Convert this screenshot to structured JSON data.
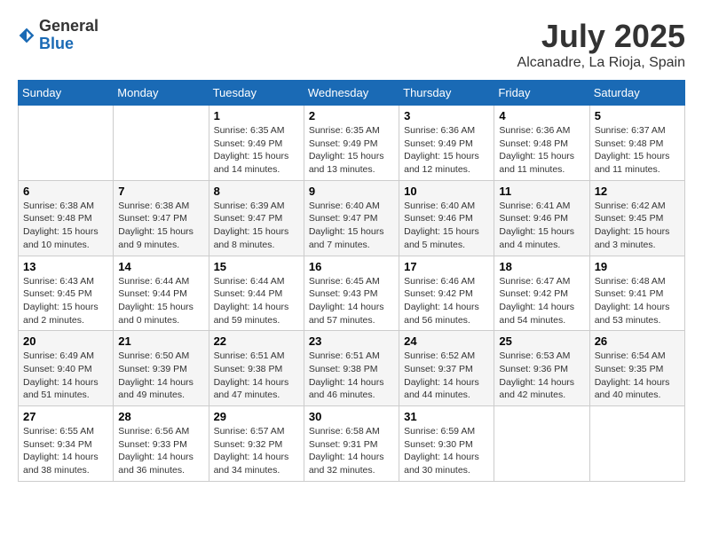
{
  "logo": {
    "general": "General",
    "blue": "Blue"
  },
  "title": "July 2025",
  "location": "Alcanadre, La Rioja, Spain",
  "weekdays": [
    "Sunday",
    "Monday",
    "Tuesday",
    "Wednesday",
    "Thursday",
    "Friday",
    "Saturday"
  ],
  "weeks": [
    [
      {
        "day": null,
        "sunrise": "",
        "sunset": "",
        "daylight": ""
      },
      {
        "day": null,
        "sunrise": "",
        "sunset": "",
        "daylight": ""
      },
      {
        "day": "1",
        "sunrise": "Sunrise: 6:35 AM",
        "sunset": "Sunset: 9:49 PM",
        "daylight": "Daylight: 15 hours and 14 minutes."
      },
      {
        "day": "2",
        "sunrise": "Sunrise: 6:35 AM",
        "sunset": "Sunset: 9:49 PM",
        "daylight": "Daylight: 15 hours and 13 minutes."
      },
      {
        "day": "3",
        "sunrise": "Sunrise: 6:36 AM",
        "sunset": "Sunset: 9:49 PM",
        "daylight": "Daylight: 15 hours and 12 minutes."
      },
      {
        "day": "4",
        "sunrise": "Sunrise: 6:36 AM",
        "sunset": "Sunset: 9:48 PM",
        "daylight": "Daylight: 15 hours and 11 minutes."
      },
      {
        "day": "5",
        "sunrise": "Sunrise: 6:37 AM",
        "sunset": "Sunset: 9:48 PM",
        "daylight": "Daylight: 15 hours and 11 minutes."
      }
    ],
    [
      {
        "day": "6",
        "sunrise": "Sunrise: 6:38 AM",
        "sunset": "Sunset: 9:48 PM",
        "daylight": "Daylight: 15 hours and 10 minutes."
      },
      {
        "day": "7",
        "sunrise": "Sunrise: 6:38 AM",
        "sunset": "Sunset: 9:47 PM",
        "daylight": "Daylight: 15 hours and 9 minutes."
      },
      {
        "day": "8",
        "sunrise": "Sunrise: 6:39 AM",
        "sunset": "Sunset: 9:47 PM",
        "daylight": "Daylight: 15 hours and 8 minutes."
      },
      {
        "day": "9",
        "sunrise": "Sunrise: 6:40 AM",
        "sunset": "Sunset: 9:47 PM",
        "daylight": "Daylight: 15 hours and 7 minutes."
      },
      {
        "day": "10",
        "sunrise": "Sunrise: 6:40 AM",
        "sunset": "Sunset: 9:46 PM",
        "daylight": "Daylight: 15 hours and 5 minutes."
      },
      {
        "day": "11",
        "sunrise": "Sunrise: 6:41 AM",
        "sunset": "Sunset: 9:46 PM",
        "daylight": "Daylight: 15 hours and 4 minutes."
      },
      {
        "day": "12",
        "sunrise": "Sunrise: 6:42 AM",
        "sunset": "Sunset: 9:45 PM",
        "daylight": "Daylight: 15 hours and 3 minutes."
      }
    ],
    [
      {
        "day": "13",
        "sunrise": "Sunrise: 6:43 AM",
        "sunset": "Sunset: 9:45 PM",
        "daylight": "Daylight: 15 hours and 2 minutes."
      },
      {
        "day": "14",
        "sunrise": "Sunrise: 6:44 AM",
        "sunset": "Sunset: 9:44 PM",
        "daylight": "Daylight: 15 hours and 0 minutes."
      },
      {
        "day": "15",
        "sunrise": "Sunrise: 6:44 AM",
        "sunset": "Sunset: 9:44 PM",
        "daylight": "Daylight: 14 hours and 59 minutes."
      },
      {
        "day": "16",
        "sunrise": "Sunrise: 6:45 AM",
        "sunset": "Sunset: 9:43 PM",
        "daylight": "Daylight: 14 hours and 57 minutes."
      },
      {
        "day": "17",
        "sunrise": "Sunrise: 6:46 AM",
        "sunset": "Sunset: 9:42 PM",
        "daylight": "Daylight: 14 hours and 56 minutes."
      },
      {
        "day": "18",
        "sunrise": "Sunrise: 6:47 AM",
        "sunset": "Sunset: 9:42 PM",
        "daylight": "Daylight: 14 hours and 54 minutes."
      },
      {
        "day": "19",
        "sunrise": "Sunrise: 6:48 AM",
        "sunset": "Sunset: 9:41 PM",
        "daylight": "Daylight: 14 hours and 53 minutes."
      }
    ],
    [
      {
        "day": "20",
        "sunrise": "Sunrise: 6:49 AM",
        "sunset": "Sunset: 9:40 PM",
        "daylight": "Daylight: 14 hours and 51 minutes."
      },
      {
        "day": "21",
        "sunrise": "Sunrise: 6:50 AM",
        "sunset": "Sunset: 9:39 PM",
        "daylight": "Daylight: 14 hours and 49 minutes."
      },
      {
        "day": "22",
        "sunrise": "Sunrise: 6:51 AM",
        "sunset": "Sunset: 9:38 PM",
        "daylight": "Daylight: 14 hours and 47 minutes."
      },
      {
        "day": "23",
        "sunrise": "Sunrise: 6:51 AM",
        "sunset": "Sunset: 9:38 PM",
        "daylight": "Daylight: 14 hours and 46 minutes."
      },
      {
        "day": "24",
        "sunrise": "Sunrise: 6:52 AM",
        "sunset": "Sunset: 9:37 PM",
        "daylight": "Daylight: 14 hours and 44 minutes."
      },
      {
        "day": "25",
        "sunrise": "Sunrise: 6:53 AM",
        "sunset": "Sunset: 9:36 PM",
        "daylight": "Daylight: 14 hours and 42 minutes."
      },
      {
        "day": "26",
        "sunrise": "Sunrise: 6:54 AM",
        "sunset": "Sunset: 9:35 PM",
        "daylight": "Daylight: 14 hours and 40 minutes."
      }
    ],
    [
      {
        "day": "27",
        "sunrise": "Sunrise: 6:55 AM",
        "sunset": "Sunset: 9:34 PM",
        "daylight": "Daylight: 14 hours and 38 minutes."
      },
      {
        "day": "28",
        "sunrise": "Sunrise: 6:56 AM",
        "sunset": "Sunset: 9:33 PM",
        "daylight": "Daylight: 14 hours and 36 minutes."
      },
      {
        "day": "29",
        "sunrise": "Sunrise: 6:57 AM",
        "sunset": "Sunset: 9:32 PM",
        "daylight": "Daylight: 14 hours and 34 minutes."
      },
      {
        "day": "30",
        "sunrise": "Sunrise: 6:58 AM",
        "sunset": "Sunset: 9:31 PM",
        "daylight": "Daylight: 14 hours and 32 minutes."
      },
      {
        "day": "31",
        "sunrise": "Sunrise: 6:59 AM",
        "sunset": "Sunset: 9:30 PM",
        "daylight": "Daylight: 14 hours and 30 minutes."
      },
      {
        "day": null,
        "sunrise": "",
        "sunset": "",
        "daylight": ""
      },
      {
        "day": null,
        "sunrise": "",
        "sunset": "",
        "daylight": ""
      }
    ]
  ]
}
